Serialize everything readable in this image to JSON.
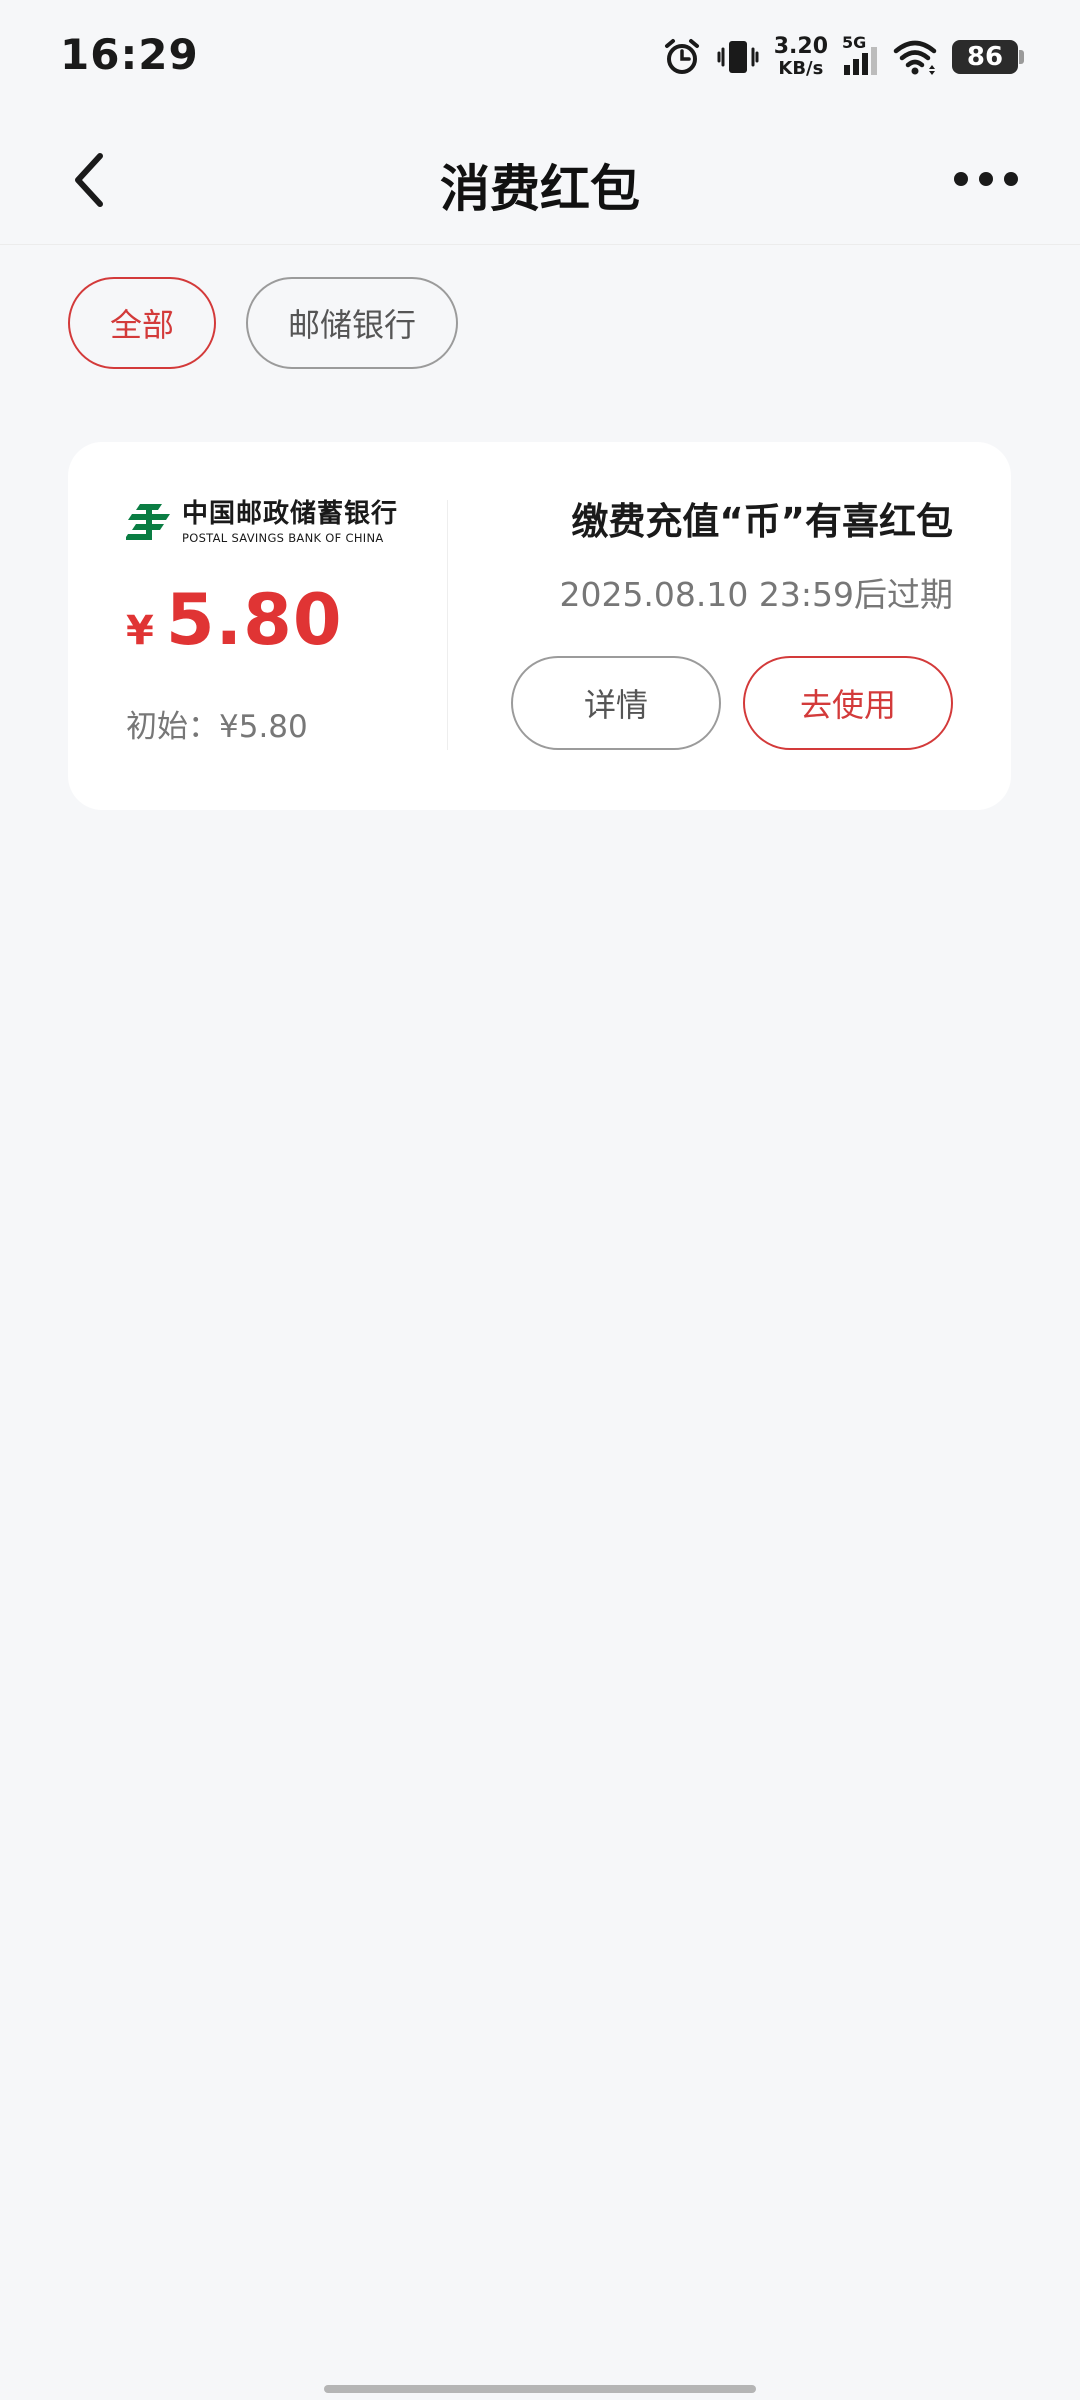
{
  "status_bar": {
    "time": "16:29",
    "net_speed_value": "3.20",
    "net_speed_unit": "KB/s",
    "network_type": "5G",
    "battery_level": "86",
    "icons": [
      "alarm-icon",
      "vibrate-icon",
      "signal-icon",
      "wifi-icon",
      "battery-icon"
    ]
  },
  "header": {
    "title": "消费红包",
    "back_icon": "chevron-left-icon",
    "more_icon": "more-horizontal-icon"
  },
  "filters": [
    {
      "label": "全部",
      "active": true
    },
    {
      "label": "邮储银行",
      "active": false
    }
  ],
  "coupon": {
    "bank_name_cn": "中国邮政储蓄银行",
    "bank_name_en": "POSTAL SAVINGS BANK OF CHINA",
    "currency": "¥",
    "amount": "5.80",
    "initial_label": "初始：¥5.80",
    "title": "缴费充值“币”有喜红包",
    "expiry": "2025.08.10 23:59后过期",
    "detail_button": "详情",
    "use_button": "去使用"
  },
  "colors": {
    "accent": "#d33a3a",
    "amount": "#e03434",
    "background": "#f6f7f9",
    "logo_green": "#0a7d43"
  }
}
